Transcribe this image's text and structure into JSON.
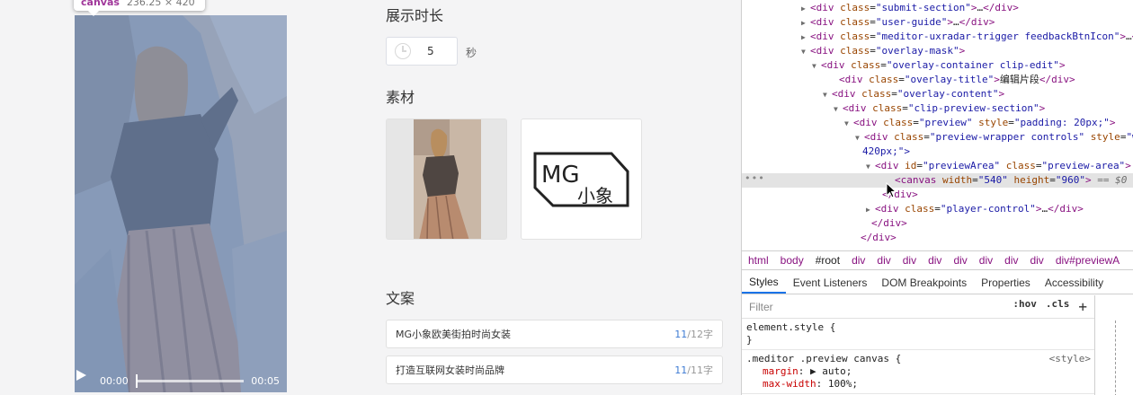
{
  "preview": {
    "tooltip_tag": "canvas",
    "tooltip_size": "236.25 × 420",
    "time_current": "00:00",
    "time_total": "00:05",
    "overlay_color": "#6f92c7"
  },
  "form": {
    "duration_title": "展示时长",
    "duration_value": "5",
    "duration_unit": "秒",
    "materials_title": "素材",
    "material_logo_text_top": "MG",
    "material_logo_text_bottom": "小象",
    "copy_title": "文案",
    "copy_rows": [
      {
        "text": "MG小象欧美街拍时尚女装",
        "count_current": "11",
        "count_max": "/12字"
      },
      {
        "text": "打造互联网女装时尚品牌",
        "count_current": "11",
        "count_max": "/11字"
      }
    ]
  },
  "devtools": {
    "dom_lines": [
      {
        "tri": "▶",
        "open": "<",
        "tag": "div",
        "attrs": [
          [
            "class",
            "\"submit-section\""
          ]
        ],
        "close": ">…</",
        "tag2": "div",
        "end": ">"
      },
      {
        "tri": "▶",
        "open": "<",
        "tag": "div",
        "attrs": [
          [
            "class",
            "\"user-guide\""
          ]
        ],
        "close": ">…</",
        "tag2": "div",
        "end": ">"
      },
      {
        "tri": "▶",
        "open": "<",
        "tag": "div",
        "attrs": [
          [
            "class",
            "\"meditor-uxradar-trigger feedbackBtnIcon\""
          ]
        ],
        "close": ">…</",
        "tag2": "div",
        "end": ">"
      },
      {
        "tri": "▼",
        "open": "<",
        "tag": "div",
        "attrs": [
          [
            "class",
            "\"overlay-mask\""
          ]
        ],
        "close": ">",
        "tag2": "",
        "end": ""
      },
      {
        "tri": "▼",
        "open": "<",
        "tag": "div",
        "attrs": [
          [
            "class",
            "\"overlay-container clip-edit\""
          ]
        ],
        "close": ">",
        "tag2": "",
        "end": ""
      },
      {
        "tri": "",
        "open": "<",
        "tag": "div",
        "attrs": [
          [
            "class",
            "\"overlay-title\""
          ]
        ],
        "close": ">编辑片段</",
        "tag2": "div",
        "end": ">"
      },
      {
        "tri": "▼",
        "open": "<",
        "tag": "div",
        "attrs": [
          [
            "class",
            "\"overlay-content\""
          ]
        ],
        "close": ">",
        "tag2": "",
        "end": ""
      },
      {
        "tri": "▼",
        "open": "<",
        "tag": "div",
        "attrs": [
          [
            "class",
            "\"clip-preview-section\""
          ]
        ],
        "close": ">",
        "tag2": "",
        "end": ""
      },
      {
        "tri": "▼",
        "open": "<",
        "tag": "div",
        "attrs": [
          [
            "class",
            "\"preview\""
          ],
          [
            "style",
            "\"padding: 20px;\""
          ]
        ],
        "close": ">",
        "tag2": "",
        "end": ""
      },
      {
        "tri": "▼",
        "open": "<",
        "tag": "div",
        "attrs": [
          [
            "class",
            "\"preview-wrapper controls\""
          ],
          [
            "style",
            "\"width"
          ]
        ],
        "close": "",
        "tag2": "",
        "end": ""
      },
      {
        "tri": "",
        "open": "",
        "tag": "",
        "attrs": [],
        "close": "",
        "tag2": "",
        "end": "",
        "raw": "420px;\">"
      },
      {
        "tri": "▼",
        "open": "<",
        "tag": "div",
        "attrs": [
          [
            "id",
            "\"previewArea\""
          ],
          [
            "class",
            "\"preview-area\""
          ]
        ],
        "close": ">",
        "tag2": "",
        "end": ""
      },
      {
        "tri": "",
        "open": "<",
        "tag": "canvas",
        "attrs": [
          [
            "width",
            "\"540\""
          ],
          [
            "height",
            "\"960\""
          ]
        ],
        "close": ">",
        "tag2": "",
        "end": "",
        "eq": " == $0",
        "selected": true
      },
      {
        "tri": "",
        "open": "</",
        "tag": "div",
        "attrs": [],
        "close": ">",
        "tag2": "",
        "end": ""
      },
      {
        "tri": "▶",
        "open": "<",
        "tag": "div",
        "attrs": [
          [
            "class",
            "\"player-control\""
          ]
        ],
        "close": ">…</",
        "tag2": "div",
        "end": ">"
      },
      {
        "tri": "",
        "open": "</",
        "tag": "div",
        "attrs": [],
        "close": ">",
        "tag2": "",
        "end": ""
      },
      {
        "tri": "",
        "open": "</",
        "tag": "div",
        "attrs": [],
        "close": ">",
        "tag2": "",
        "end": ""
      },
      {
        "tri": "",
        "open": "</",
        "tag": "div",
        "attrs": [],
        "close": ">",
        "tag2": "",
        "end": ""
      }
    ],
    "breadcrumbs": [
      "html",
      "body",
      "#root",
      "div",
      "div",
      "div",
      "div",
      "div",
      "div",
      "div",
      "div",
      "div#previewA"
    ],
    "tabs": [
      "Styles",
      "Event Listeners",
      "DOM Breakpoints",
      "Properties",
      "Accessibility"
    ],
    "filter_placeholder": "Filter",
    "hov": ":hov",
    "cls": ".cls",
    "add_rule": "+",
    "rule1_selector": "element.style {",
    "rule1_close": "}",
    "rule2_selector": ".meditor .preview canvas {",
    "rule2_source": "<style>",
    "rule2_props": [
      {
        "name": "margin",
        "value": "▶ auto;"
      },
      {
        "name": "max-width",
        "value": "100%;"
      }
    ]
  }
}
